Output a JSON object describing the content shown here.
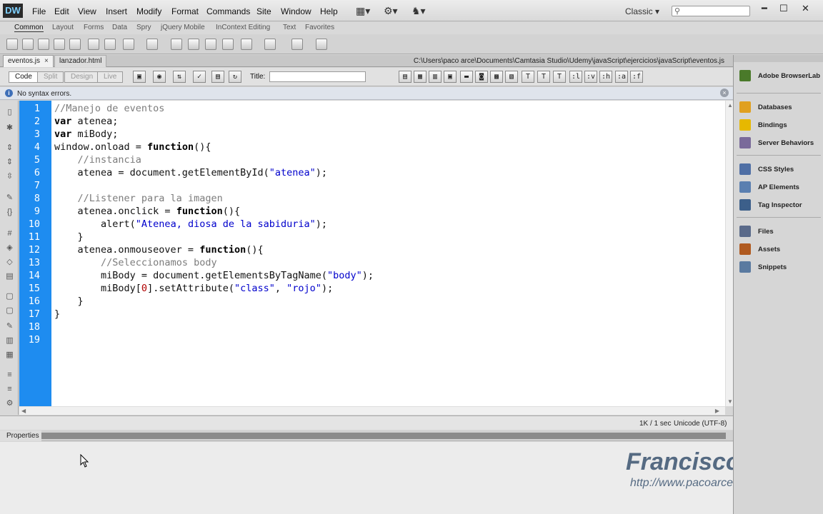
{
  "app": {
    "logo": "DW",
    "menu": [
      "File",
      "Edit",
      "View",
      "Insert",
      "Modify",
      "Format",
      "Commands",
      "Site",
      "Window",
      "Help"
    ],
    "workspace": "Classic",
    "search_placeholder": ""
  },
  "insert_panel": {
    "tabs": [
      "Common",
      "Layout",
      "Forms",
      "Data",
      "Spry",
      "jQuery Mobile",
      "InContext Editing",
      "Text",
      "Favorites"
    ],
    "active_tab": "Common"
  },
  "documents": {
    "tabs": [
      {
        "label": "eventos.js",
        "active": true
      },
      {
        "label": "lanzador.html",
        "active": false
      }
    ],
    "path": "C:\\Users\\paco arce\\Documents\\Camtasia Studio\\Udemy\\javaScript\\ejercicios\\javaScript\\eventos.js"
  },
  "doc_toolbar": {
    "views": [
      "Code",
      "Split",
      "Design",
      "Live"
    ],
    "title_label": "Title:",
    "title_value": "",
    "code_buttons": [
      ":l",
      ":v",
      ":h",
      ":a",
      ":f"
    ]
  },
  "infobar": {
    "message": "No syntax errors."
  },
  "editor": {
    "gutter_color": "#1e8cf0",
    "lines": [
      {
        "n": "1",
        "html": "<span class=\"cmt\">//Manejo de eventos</span>"
      },
      {
        "n": "2",
        "html": "<span class=\"kw\">var</span> atenea;"
      },
      {
        "n": "3",
        "html": "<span class=\"kw\">var</span> miBody;"
      },
      {
        "n": "4",
        "html": "window.onload = <span class=\"kw\">function</span>(){"
      },
      {
        "n": "5",
        "html": "    <span class=\"cmt\">//instancia</span>"
      },
      {
        "n": "6",
        "html": "    atenea = document.getElementById(<span class=\"str\">\"atenea\"</span>);"
      },
      {
        "n": "7",
        "html": ""
      },
      {
        "n": "8",
        "html": "    <span class=\"cmt\">//Listener para la imagen</span>"
      },
      {
        "n": "9",
        "html": "    atenea.onclick = <span class=\"kw\">function</span>(){"
      },
      {
        "n": "10",
        "html": "        alert(<span class=\"str\">\"Atenea, diosa de la sabiduria\"</span>);"
      },
      {
        "n": "11",
        "html": "    }"
      },
      {
        "n": "12",
        "html": "    atenea.onmouseover = <span class=\"kw\">function</span>(){"
      },
      {
        "n": "13",
        "html": "        <span class=\"cmt\">//Seleccionamos body</span>"
      },
      {
        "n": "14",
        "html": "        miBody = document.getElementsByTagName(<span class=\"str\">\"body\"</span>);"
      },
      {
        "n": "15",
        "html": "        miBody[<span class=\"num\">0</span>].setAttribute(<span class=\"str\">\"class\"</span>, <span class=\"str\">\"rojo\"</span>);"
      },
      {
        "n": "16",
        "html": "    }"
      },
      {
        "n": "17",
        "html": "}"
      },
      {
        "n": "18",
        "html": ""
      },
      {
        "n": "19",
        "html": ""
      }
    ]
  },
  "status": {
    "size_time": "1K / 1 sec",
    "encoding": "Unicode (UTF-8)"
  },
  "properties": {
    "title": "Properties"
  },
  "watermark": {
    "name": "Francisco Arce",
    "url": "http://www.pacoarce.com"
  },
  "right_panels": [
    {
      "label": "Adobe BrowserLab",
      "icon": "browserlab-icon",
      "color": "#4a7a2a"
    },
    {
      "label": "Databases",
      "icon": "databases-icon",
      "color": "#e0a020"
    },
    {
      "label": "Bindings",
      "icon": "bindings-icon",
      "color": "#e6b800"
    },
    {
      "label": "Server Behaviors",
      "icon": "server-behaviors-icon",
      "color": "#7a6a9a"
    },
    {
      "label": "CSS Styles",
      "icon": "css-styles-icon",
      "color": "#4f6fa5"
    },
    {
      "label": "AP Elements",
      "icon": "ap-elements-icon",
      "color": "#5a7fb0"
    },
    {
      "label": "Tag Inspector",
      "icon": "tag-inspector-icon",
      "color": "#3c5f8a"
    },
    {
      "label": "Files",
      "icon": "files-icon",
      "color": "#5a6a8a"
    },
    {
      "label": "Assets",
      "icon": "assets-icon",
      "color": "#b05a20"
    },
    {
      "label": "Snippets",
      "icon": "snippets-icon",
      "color": "#5a7aa0"
    }
  ]
}
